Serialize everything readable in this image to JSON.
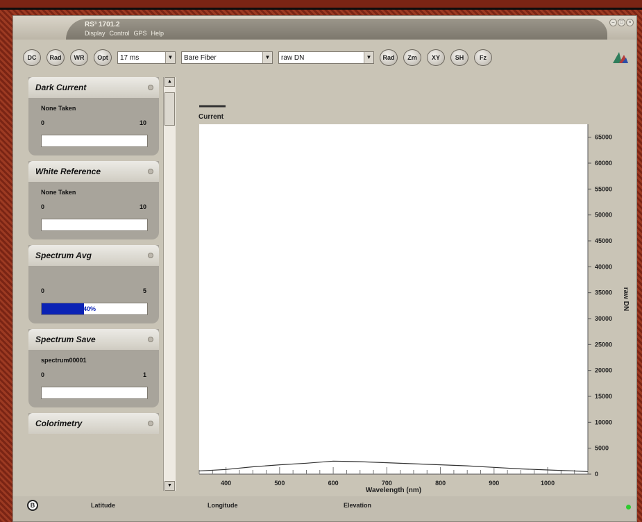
{
  "app": {
    "title": "RS³ 1701.2",
    "menu": [
      "Display",
      "Control",
      "GPS",
      "Help"
    ],
    "window_controls": [
      "–",
      "□",
      "×"
    ]
  },
  "toolbar": {
    "buttons_left": [
      "DC",
      "Rad",
      "WR",
      "Opt"
    ],
    "integration_time": "17 ms",
    "fiber": "Bare Fiber",
    "mode": "raw DN",
    "buttons_right": [
      "Rad",
      "Zm",
      "XY",
      "SH",
      "Fz"
    ]
  },
  "panels": {
    "dark_current": {
      "title": "Dark Current",
      "status": "None Taken",
      "min": "0",
      "max": "10",
      "progress": 0
    },
    "white_reference": {
      "title": "White Reference",
      "status": "None Taken",
      "min": "0",
      "max": "10",
      "progress": 0
    },
    "spectrum_avg": {
      "title": "Spectrum Avg",
      "status": "",
      "min": "0",
      "max": "5",
      "progress": 0.4,
      "progress_label": "40%"
    },
    "spectrum_save": {
      "title": "Spectrum Save",
      "status": "spectrum00001",
      "min": "0",
      "max": "1",
      "progress": 0
    },
    "colorimetry": {
      "title": "Colorimetry"
    }
  },
  "status": {
    "latitude": "Latitude",
    "longitude": "Longitude",
    "elevation": "Elevation"
  },
  "colors": {
    "progress_fill": "#0a22b5",
    "led": "#2ecc2e"
  },
  "chart_data": {
    "type": "line",
    "legend": "Current",
    "xlabel": "Wavelength (nm)",
    "ylabel": "raw DN",
    "xlim": [
      350,
      1075
    ],
    "ylim": [
      0,
      67500
    ],
    "x_ticks": [
      400,
      500,
      600,
      700,
      800,
      900,
      1000
    ],
    "y_ticks": [
      0,
      5000,
      10000,
      15000,
      20000,
      25000,
      30000,
      35000,
      40000,
      45000,
      50000,
      55000,
      60000,
      65000
    ],
    "y_axis_position": "right",
    "legend_position": "top-left",
    "series": [
      {
        "name": "Current",
        "x": [
          350,
          400,
          450,
          500,
          550,
          600,
          650,
          700,
          750,
          800,
          850,
          900,
          950,
          1000,
          1050,
          1075
        ],
        "y": [
          600,
          900,
          1400,
          1800,
          2100,
          2500,
          2400,
          2200,
          2000,
          1800,
          1600,
          1300,
          1000,
          800,
          600,
          500
        ]
      }
    ]
  }
}
